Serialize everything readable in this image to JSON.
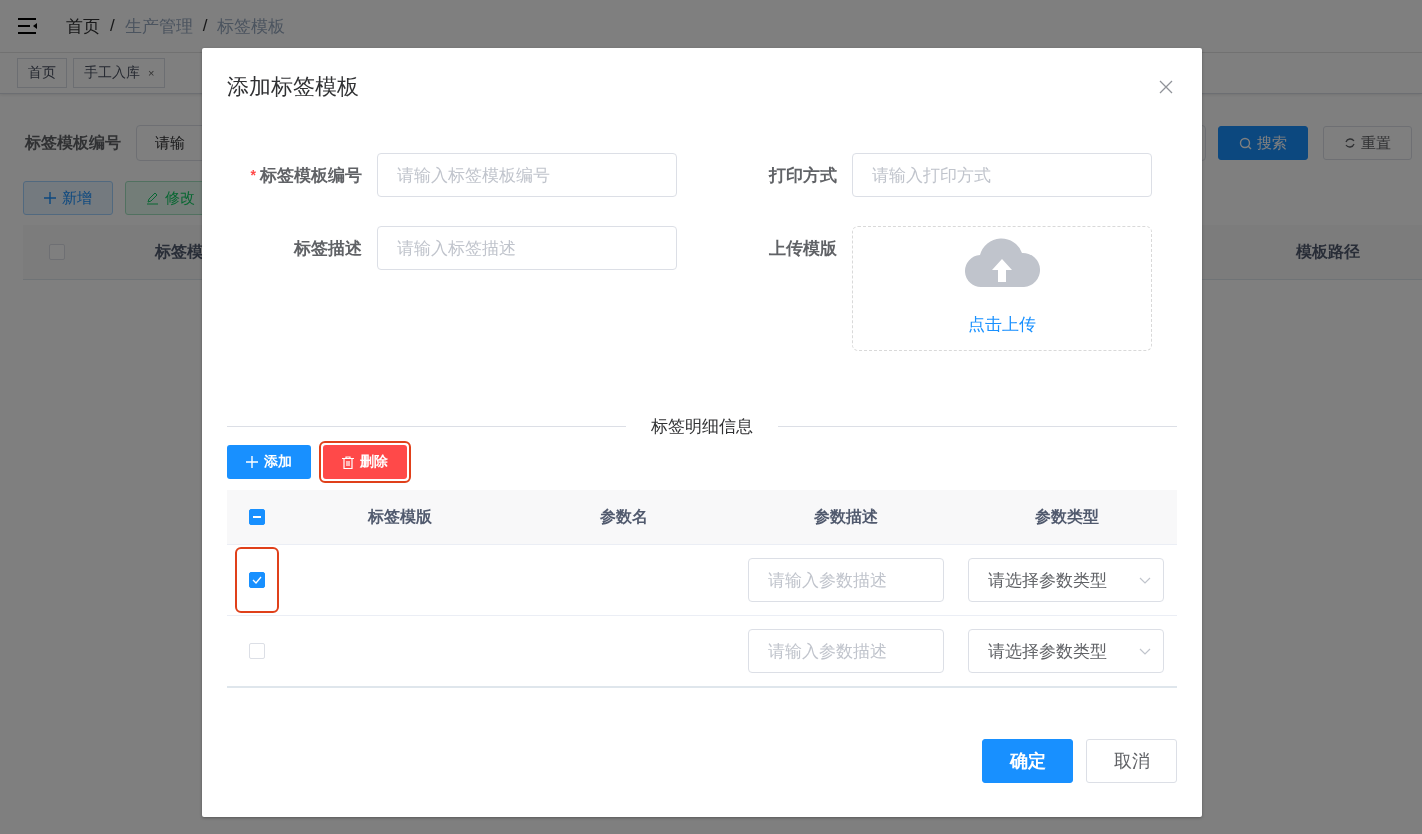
{
  "header": {
    "breadcrumb": [
      {
        "label": "首页",
        "link": true
      },
      {
        "separator": "/",
        "label": "生产管理",
        "link": false
      },
      {
        "separator": "/",
        "label": "标签模板",
        "link": false
      }
    ]
  },
  "tags": [
    {
      "label": "首页"
    },
    {
      "label": "手工入库",
      "close": "×"
    }
  ],
  "filter": {
    "label": "标签模板编号",
    "placeholder": "请输",
    "search_button": "搜索",
    "reset_button": "重置"
  },
  "toolbar": [
    {
      "label": "新增",
      "kind": "add"
    },
    {
      "label": "修改",
      "kind": "edit"
    }
  ],
  "list_table": {
    "columns": [
      "标签模",
      "模板路径"
    ],
    "select_all_checked": false
  },
  "dialog": {
    "title": "添加标签模板",
    "fields": [
      {
        "kind": "input",
        "required_mark": "*",
        "label": "标签模板编号",
        "placeholder": "请输入标签模板编号"
      },
      {
        "kind": "input",
        "label": "打印方式",
        "placeholder": "请输入打印方式"
      },
      {
        "kind": "input",
        "label": "标签描述",
        "placeholder": "请输入标签描述"
      },
      {
        "kind": "upload",
        "label": "上传模版",
        "link": "点击上传"
      }
    ],
    "section_title": "标签明细信息",
    "buttons": [
      {
        "label": "添加",
        "kind": "primary",
        "highlighted": false
      },
      {
        "label": "删除",
        "kind": "danger",
        "highlighted": true
      }
    ],
    "table": {
      "columns": [
        "标签模版",
        "参数名",
        "参数描述",
        "参数类型"
      ],
      "select_all_indeterminate": true,
      "rows": [
        {
          "checked": true,
          "highlighted": true,
          "description_placeholder": "请输入参数描述",
          "type_placeholder": "请选择参数类型"
        },
        {
          "checked": false,
          "highlighted": false,
          "description_placeholder": "请输入参数描述",
          "type_placeholder": "请选择参数类型"
        }
      ]
    },
    "footer": [
      {
        "label": "确定",
        "kind": "primary"
      },
      {
        "label": "取消",
        "kind": "default"
      }
    ]
  }
}
